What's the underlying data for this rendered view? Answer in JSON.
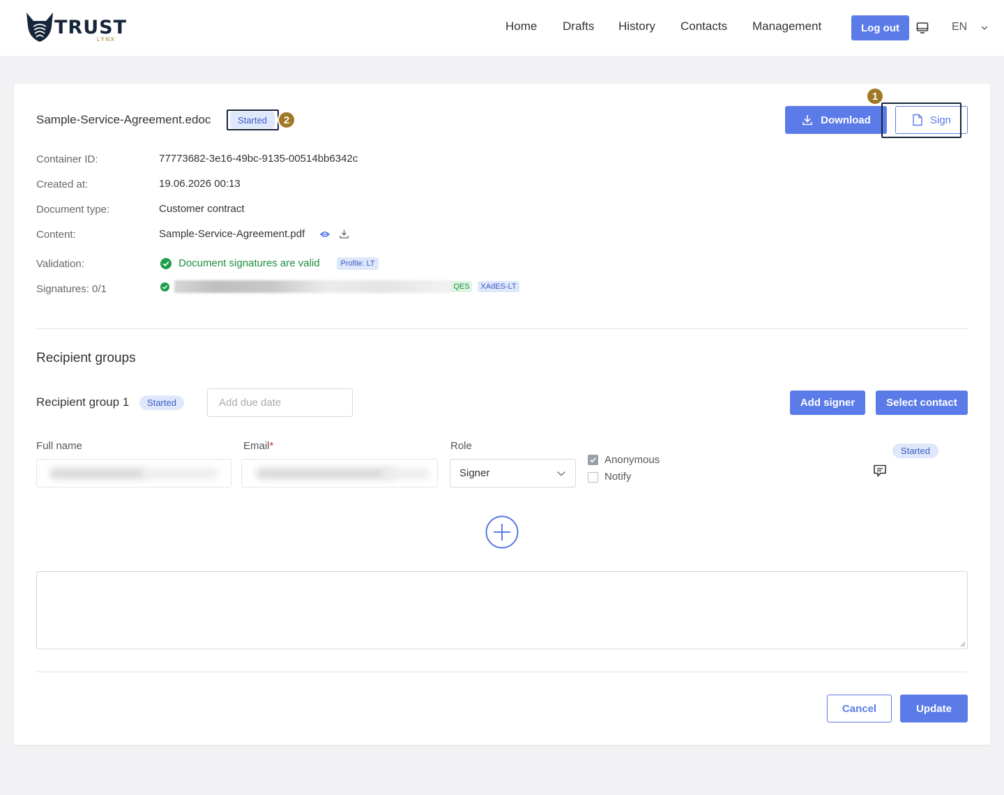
{
  "header": {
    "logo_text": "TRUST",
    "logo_sub": "LYNX",
    "nav": [
      "Home",
      "Drafts",
      "History",
      "Contacts",
      "Management"
    ],
    "logout_label": "Log out",
    "language": "EN"
  },
  "document": {
    "filename": "Sample-Service-Agreement.edoc",
    "status": "Started",
    "download_label": "Download",
    "sign_label": "Sign",
    "step_markers": [
      "1",
      "2"
    ],
    "fields": {
      "container_id_label": "Container ID:",
      "container_id": "77773682-3e16-49bc-9135-00514bb6342c",
      "created_at_label": "Created at:",
      "created_at": "19.06.2026 00:13",
      "doc_type_label": "Document type:",
      "doc_type": "Customer contract",
      "content_label": "Content:",
      "content": "Sample-Service-Agreement.pdf",
      "validation_label": "Validation:",
      "validation": "Document signatures are valid",
      "profile_tag": "Profile: LT",
      "signatures_label": "Signatures: 0/1",
      "sig_level": "QES",
      "sig_format": "XAdES-LT"
    }
  },
  "recipients": {
    "section_title": "Recipient groups",
    "group_title": "Recipient group 1",
    "group_status": "Started",
    "due_date_placeholder": "Add due date",
    "add_signer_label": "Add signer",
    "select_contact_label": "Select contact",
    "columns": {
      "full_name": "Full name",
      "email": "Email",
      "email_required": "*",
      "role": "Role"
    },
    "row": {
      "role": "Signer",
      "anonymous_label": "Anonymous",
      "anonymous_checked": true,
      "notify_label": "Notify",
      "notify_checked": false,
      "status": "Started"
    }
  },
  "footer": {
    "cancel_label": "Cancel",
    "update_label": "Update"
  },
  "colors": {
    "accent": "#5b7be8",
    "success": "#1e8c3e",
    "badge_bg": "#dfe7fb",
    "marker": "#a17825",
    "highlight_border": "#15253a"
  }
}
